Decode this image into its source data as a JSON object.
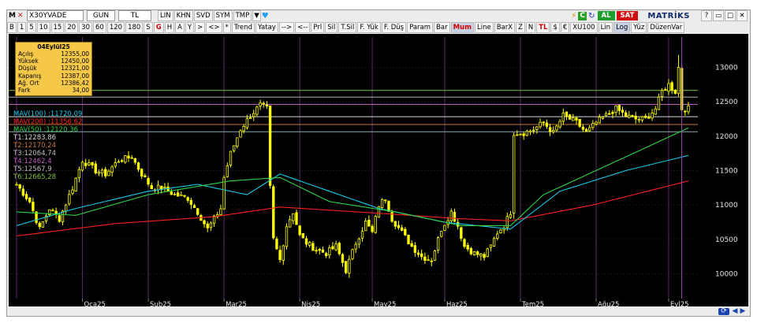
{
  "toolbar": {
    "m_label": "M",
    "symbol": "X30YVADE",
    "period": "GUN",
    "currency": "TL",
    "buttons1": [
      "LIN",
      "KHN",
      "SVD",
      "SYM",
      "TMP"
    ],
    "al_label": "AL",
    "sat_label": "SAT",
    "brand": "MATRİKS"
  },
  "toolbar2": {
    "buttons": [
      "B",
      "1",
      "5",
      "10",
      "15",
      "20",
      "30",
      "60",
      "120",
      "180",
      "S",
      "G",
      "H",
      "A",
      "Y",
      ">",
      "<>",
      "*",
      "Trend",
      "Yatay",
      "-->",
      "<--",
      "Prl",
      "Sil",
      "T.Sil",
      "F. Yük",
      "F. Düş",
      "Param",
      "Bar",
      "Mum",
      "Line",
      "BarX",
      "Z",
      "N",
      "TL",
      "$",
      "€",
      "XU100",
      "Lin",
      "Log",
      "Yüz",
      "DüzenVar"
    ]
  },
  "infobox": {
    "title": "04Eylül25",
    "rows": [
      {
        "label": "Açılış",
        "value": "12355,00"
      },
      {
        "label": "Yüksek",
        "value": "12450,00"
      },
      {
        "label": "Düşük",
        "value": "12321,00"
      },
      {
        "label": "Kapanış",
        "value": "12387,00"
      },
      {
        "label": "Ağ. Ort",
        "value": "12386,42"
      },
      {
        "label": "Fark",
        "value": "34,00"
      }
    ]
  },
  "legend": [
    {
      "text": "MAV(100)     :11720,09",
      "color": "#19c8e8"
    },
    {
      "text": "MAV(200)     :11356,62",
      "color": "#ff2020"
    },
    {
      "text": "MAV(50)      :12120,36",
      "color": "#2fd24a"
    },
    {
      "text": "T1:12283,86",
      "color": "#d8d8d8"
    },
    {
      "text": "T2:12170,24",
      "color": "#c87838"
    },
    {
      "text": "T3:12064,74",
      "color": "#c0c0c0"
    },
    {
      "text": "T4:12462,4",
      "color": "#c060c0"
    },
    {
      "text": "T5:12567,9",
      "color": "#c0c0c0"
    },
    {
      "text": "T6:12665,28",
      "color": "#80c040"
    }
  ],
  "colors": {
    "candle": "#ffff00",
    "mav100": "#19c8e8",
    "mav200": "#ff2020",
    "mav50": "#2fd24a",
    "background": "#000000",
    "grid": "#5a2a6a"
  },
  "chart_data": {
    "type": "candlestick",
    "title": "",
    "xlabel": "",
    "ylabel": "",
    "ylim": [
      9800,
      13350
    ],
    "yticks": [
      10000,
      10500,
      11000,
      11500,
      12000,
      12500,
      13000
    ],
    "x_tick_labels": [
      "Oca25",
      "Şub25",
      "Mar25",
      "Nis25",
      "May25",
      "Haz25",
      "Tem25",
      "Ağu25",
      "Eyl25"
    ],
    "legend_position": "top-left",
    "grid": true,
    "horizontal_levels": [
      12283.86,
      12170.24,
      12064.74,
      12462.4,
      12567.9,
      12665.28
    ],
    "close_anchors": [
      [
        0,
        11300
      ],
      [
        4,
        11050
      ],
      [
        7,
        10650
      ],
      [
        10,
        10950
      ],
      [
        13,
        10800
      ],
      [
        17,
        11250
      ],
      [
        20,
        11650
      ],
      [
        24,
        11500
      ],
      [
        27,
        11450
      ],
      [
        31,
        11650
      ],
      [
        35,
        11700
      ],
      [
        38,
        11450
      ],
      [
        41,
        11250
      ],
      [
        44,
        11250
      ],
      [
        48,
        11150
      ],
      [
        52,
        11100
      ],
      [
        55,
        10900
      ],
      [
        58,
        10650
      ],
      [
        60,
        10800
      ],
      [
        62,
        10950
      ],
      [
        63,
        11400
      ],
      [
        65,
        11750
      ],
      [
        68,
        12100
      ],
      [
        71,
        12300
      ],
      [
        74,
        12450
      ],
      [
        76,
        12400
      ],
      [
        77,
        11250
      ],
      [
        78,
        10500
      ],
      [
        80,
        10200
      ],
      [
        82,
        10700
      ],
      [
        84,
        10900
      ],
      [
        86,
        10550
      ],
      [
        88,
        10450
      ],
      [
        91,
        10350
      ],
      [
        94,
        10300
      ],
      [
        97,
        10400
      ],
      [
        100,
        10050
      ],
      [
        103,
        10450
      ],
      [
        106,
        10750
      ],
      [
        108,
        10600
      ],
      [
        110,
        11000
      ],
      [
        112,
        11100
      ],
      [
        114,
        10800
      ],
      [
        117,
        10600
      ],
      [
        120,
        10400
      ],
      [
        123,
        10250
      ],
      [
        126,
        10200
      ],
      [
        129,
        10650
      ],
      [
        132,
        10900
      ],
      [
        134,
        10700
      ],
      [
        136,
        10400
      ],
      [
        139,
        10300
      ],
      [
        142,
        10250
      ],
      [
        144,
        10400
      ],
      [
        146,
        10600
      ],
      [
        148,
        10700
      ],
      [
        150,
        10900
      ],
      [
        151,
        12050
      ],
      [
        154,
        12050
      ],
      [
        157,
        12100
      ],
      [
        160,
        12200
      ],
      [
        163,
        12050
      ],
      [
        166,
        12300
      ],
      [
        170,
        12200
      ],
      [
        173,
        12050
      ],
      [
        176,
        12200
      ],
      [
        179,
        12300
      ],
      [
        182,
        12400
      ],
      [
        185,
        12300
      ],
      [
        188,
        12250
      ],
      [
        191,
        12250
      ],
      [
        194,
        12400
      ],
      [
        196,
        12650
      ],
      [
        198,
        12750
      ],
      [
        200,
        12650
      ],
      [
        201,
        13000
      ],
      [
        202,
        12400
      ],
      [
        204,
        12400
      ]
    ],
    "mav100_anchors": [
      [
        0,
        10700
      ],
      [
        18,
        10950
      ],
      [
        40,
        11200
      ],
      [
        55,
        11300
      ],
      [
        70,
        11150
      ],
      [
        80,
        11450
      ],
      [
        92,
        11250
      ],
      [
        110,
        10950
      ],
      [
        130,
        10750
      ],
      [
        150,
        10650
      ],
      [
        165,
        11200
      ],
      [
        185,
        11500
      ],
      [
        204,
        11720
      ]
    ],
    "mav200_anchors": [
      [
        0,
        10550
      ],
      [
        30,
        10730
      ],
      [
        60,
        10830
      ],
      [
        80,
        10970
      ],
      [
        110,
        10880
      ],
      [
        135,
        10800
      ],
      [
        150,
        10770
      ],
      [
        175,
        11000
      ],
      [
        204,
        11350
      ]
    ],
    "mav50_anchors": [
      [
        0,
        10900
      ],
      [
        18,
        10850
      ],
      [
        40,
        11150
      ],
      [
        65,
        11350
      ],
      [
        80,
        11400
      ],
      [
        95,
        11050
      ],
      [
        115,
        10900
      ],
      [
        135,
        10700
      ],
      [
        150,
        10700
      ],
      [
        160,
        11150
      ],
      [
        185,
        11700
      ],
      [
        204,
        12120
      ]
    ]
  }
}
